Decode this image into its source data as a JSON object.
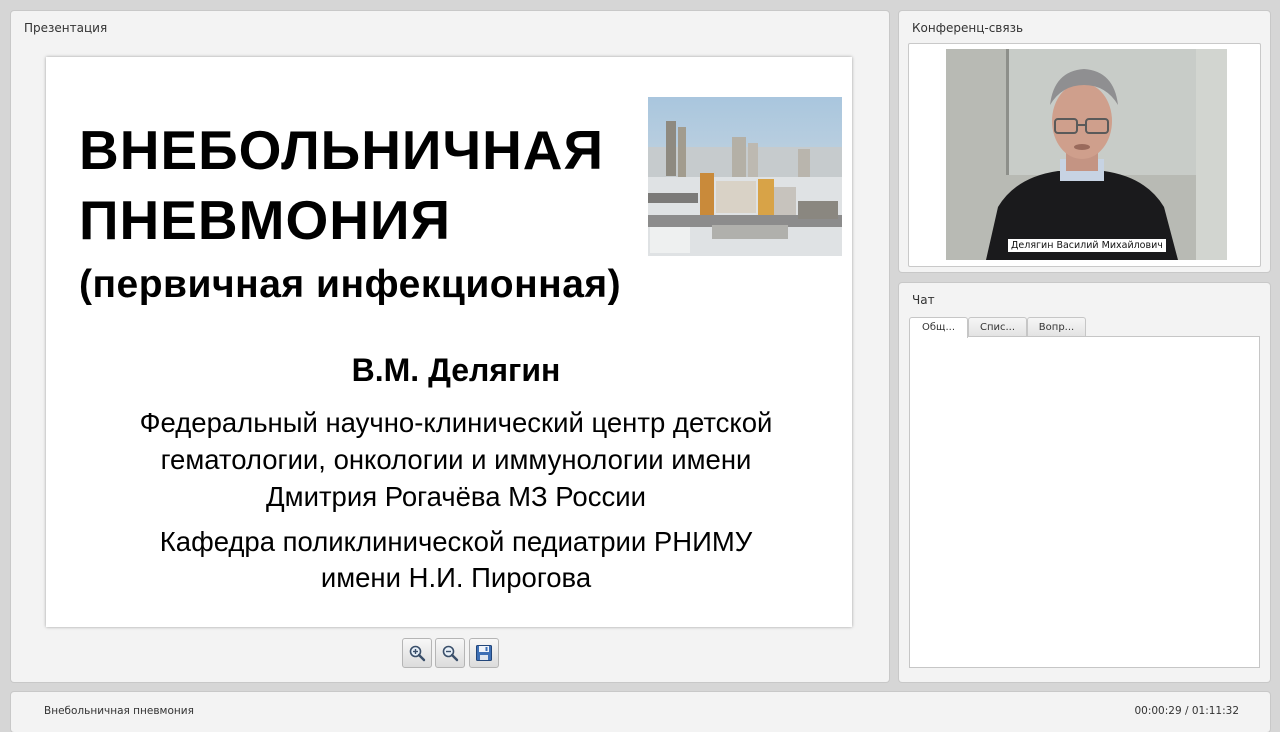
{
  "presentation": {
    "panel_title": "Презентация",
    "slide": {
      "title_line1": "ВНЕБОЛЬНИЧНАЯ",
      "title_line2": "ПНЕВМОНИЯ",
      "subtitle": "(первичная инфекционная)",
      "author": "В.М. Делягин",
      "org_line1": "Федеральный научно-клинический центр детской",
      "org_line2": "гематологии, онкологии и иммунологии имени",
      "org_line3": "Дмитрия Рогачёва МЗ России",
      "dept_line1": "Кафедра поликлинической педиатрии РНИМУ",
      "dept_line2": "имени Н.И. Пирогова"
    },
    "toolbar": {
      "zoom_in_icon": "zoom-in-icon",
      "zoom_out_icon": "zoom-out-icon",
      "save_icon": "save-icon"
    }
  },
  "conference": {
    "panel_title": "Конференц-связь",
    "speaker_name": "Делягин Василий Михайлович"
  },
  "chat": {
    "panel_title": "Чат",
    "tabs": [
      {
        "label": "Общ...",
        "active": true
      },
      {
        "label": "Спис...",
        "active": false
      },
      {
        "label": "Вопр...",
        "active": false
      }
    ]
  },
  "footer": {
    "title": "Внебольничная пневмония",
    "time": "00:00:29 / 01:11:32"
  }
}
